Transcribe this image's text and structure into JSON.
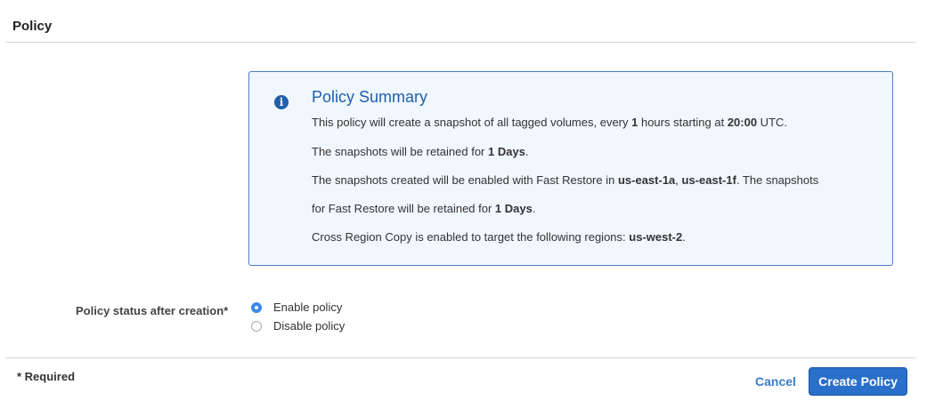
{
  "section_title": "Policy",
  "summary": {
    "title": "Policy Summary",
    "lines": [
      [
        [
          "This policy will create a snapshot of all tagged volumes, every ",
          0
        ],
        [
          "1",
          1
        ],
        [
          " hours starting at ",
          0
        ],
        [
          "20:00",
          1
        ],
        [
          " UTC.",
          0
        ]
      ],
      [
        [
          "The snapshots will be retained for ",
          0
        ],
        [
          "1 Days",
          1
        ],
        [
          ".",
          0
        ]
      ],
      [
        [
          "The snapshots created will be enabled with Fast Restore in ",
          0
        ],
        [
          "us-east-1a",
          1
        ],
        [
          ", ",
          0
        ],
        [
          "us-east-1f",
          1
        ],
        [
          ". The snapshots",
          0
        ]
      ],
      [
        [
          "for Fast Restore will be retained for ",
          0
        ],
        [
          "1 Days",
          1
        ],
        [
          ".",
          0
        ]
      ],
      [
        [
          "Cross Region Copy is enabled to target the following regions: ",
          0
        ],
        [
          "us-west-2",
          1
        ],
        [
          ".",
          0
        ]
      ]
    ]
  },
  "status": {
    "label": "Policy status after creation*",
    "options": [
      {
        "label": "Enable policy",
        "selected": true
      },
      {
        "label": "Disable policy",
        "selected": false
      }
    ]
  },
  "footer": {
    "required": "* Required",
    "cancel": "Cancel",
    "create": "Create Policy"
  }
}
